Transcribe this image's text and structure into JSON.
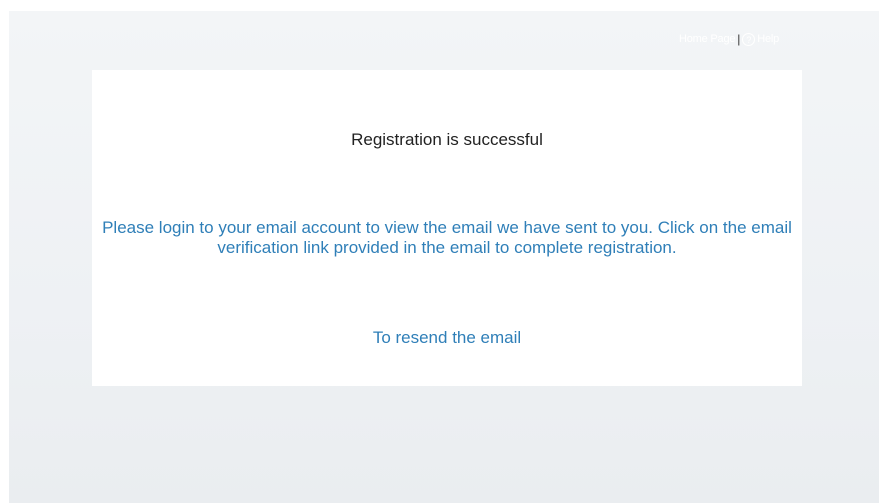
{
  "header": {
    "home_link": "Home Page",
    "separator": "|",
    "help_icon": "?",
    "help_link": "Help"
  },
  "card": {
    "title": "Registration is successful",
    "message": "Please login to your email account to view the email we have sent to you. Click on the email verification link provided in the email to complete registration.",
    "resend_link": "To resend the email"
  },
  "colors": {
    "background": "#eef1f4",
    "card": "#ffffff",
    "link_blue": "#2f7fb8",
    "title_text": "#222222"
  },
  "icons": {
    "help": "help-circle-icon"
  }
}
